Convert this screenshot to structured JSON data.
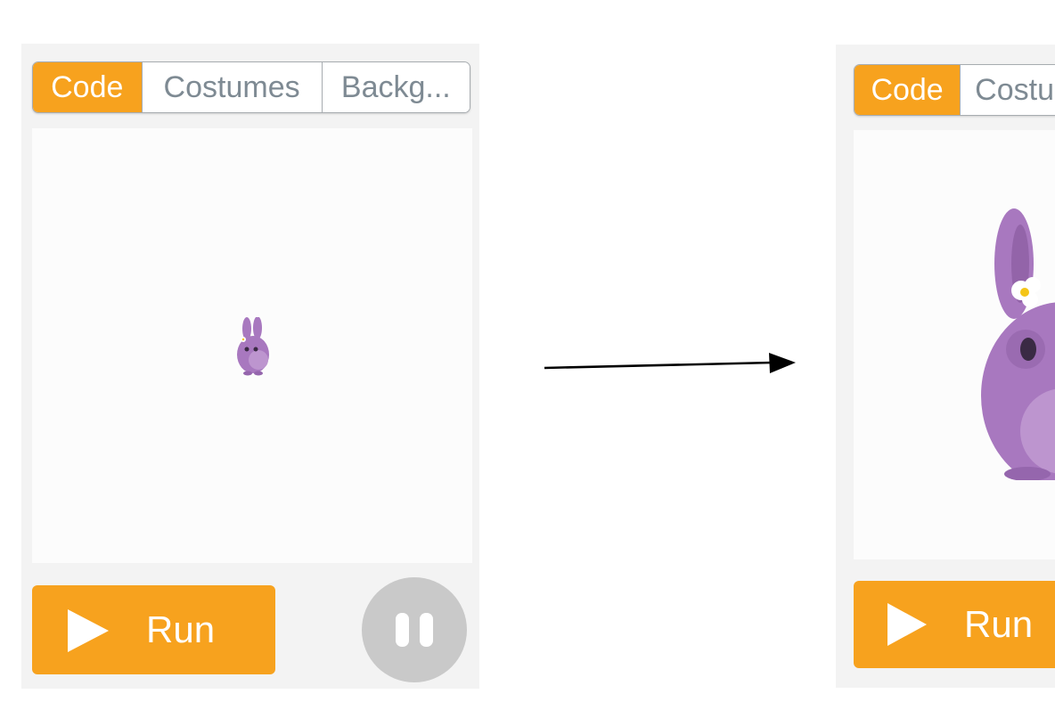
{
  "left_panel": {
    "tabs": [
      {
        "label": "Code",
        "active": true
      },
      {
        "label": "Costumes",
        "active": false
      },
      {
        "label": "Backg...",
        "active": false
      }
    ],
    "run_label": "Run",
    "sprite": "bunny-character"
  },
  "right_panel": {
    "tabs": [
      {
        "label": "Code",
        "active": true
      },
      {
        "label": "Costu",
        "active": false
      }
    ],
    "run_label": "Run",
    "sprite": "bunny-character"
  },
  "colors": {
    "accent": "#f7a21e",
    "panel_bg": "#f3f3f3",
    "stage_bg": "#fcfcfc",
    "sprite": "#a878bf",
    "pause_bg": "#c9c9c9"
  },
  "arrow_icon": "right-arrow-icon"
}
